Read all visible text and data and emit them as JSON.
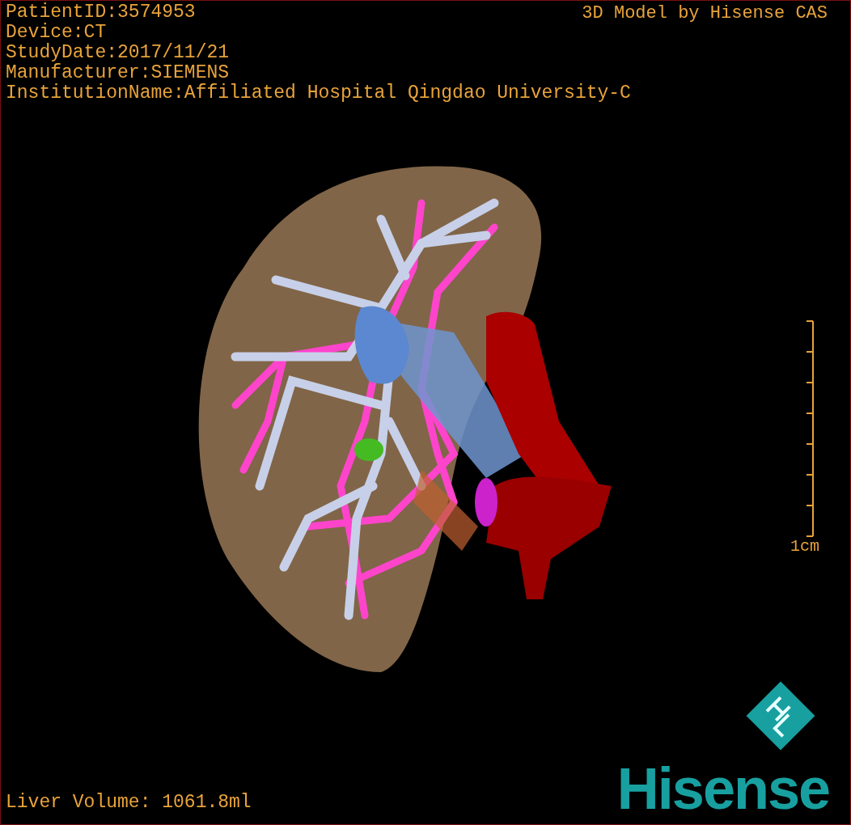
{
  "study_info": [
    "PatientID:3574953",
    "Device:CT",
    "StudyDate:2017/11/21",
    "Manufacturer:SIEMENS",
    "InstitutionName:Affiliated Hospital Qingdao University-C"
  ],
  "credit": "3D Model by Hisense CAS",
  "scale_bar": {
    "label": "1cm"
  },
  "liver_volume": "Liver Volume: 1061.8ml",
  "logo": {
    "wordmark": "Hisense"
  }
}
